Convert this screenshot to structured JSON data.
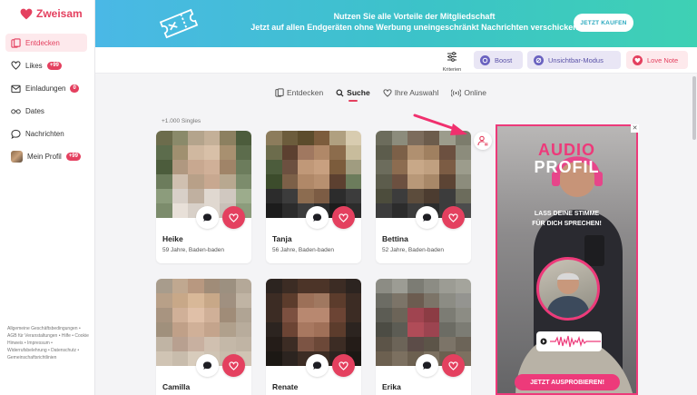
{
  "app": {
    "name": "Zweisam",
    "brand_color": "#e4405f"
  },
  "sidebar": {
    "items": [
      {
        "label": "Entdecken",
        "icon": "cards-icon",
        "active": true
      },
      {
        "label": "Likes",
        "icon": "heart-outline-icon",
        "badge": "+99"
      },
      {
        "label": "Einladungen",
        "icon": "envelope-icon",
        "badge": "0"
      },
      {
        "label": "Dates",
        "icon": "glasses-icon"
      },
      {
        "label": "Nachrichten",
        "icon": "chat-bubble-icon"
      },
      {
        "label": "Mein Profil",
        "icon": "avatar",
        "badge": "+99"
      }
    ],
    "footer": "Allgemeine Geschäftsbedingungen • AGB für Veranstaltungen • Hilfe • Cookie Hinweis • Impressum • Widerrufsbelehrung • Datenschutz • Gemeinschaftsrichtlinien"
  },
  "banner": {
    "line1": "Nutzen Sie alle Vorteile der Mitgliedschaft",
    "line2": "Jetzt auf allen Endgeräten ohne Werbung uneingeschränkt Nachrichten verschicken",
    "button": "JETZT KAUFEN"
  },
  "toolbar": {
    "criteria_label": "Kriterien",
    "boost": "Boost",
    "invisible": "Unsichtbar-Modus",
    "love_note": "Love Note"
  },
  "tabs": [
    {
      "label": "Entdecken",
      "icon": "cards-icon"
    },
    {
      "label": "Suche",
      "icon": "search-icon",
      "active": true
    },
    {
      "label": "Ihre Auswahl",
      "icon": "heart-outline-icon"
    },
    {
      "label": "Online",
      "icon": "signal-icon"
    }
  ],
  "results": {
    "count_label": "+1.000 Singles"
  },
  "profiles": [
    {
      "name": "Heike",
      "meta": "59 Jahre, Baden-baden"
    },
    {
      "name": "Tanja",
      "meta": "56 Jahre, Baden-baden"
    },
    {
      "name": "Bettina",
      "meta": "52 Jahre, Baden-baden"
    },
    {
      "name": "Camilla",
      "meta": ""
    },
    {
      "name": "Renate",
      "meta": ""
    },
    {
      "name": "Erika",
      "meta": ""
    }
  ],
  "ad": {
    "title1": "AUDIO",
    "title2": "PROFIL",
    "sub1": "LASS DEINE STIMME",
    "sub2": "FÜR DICH SPRECHEN!",
    "cta": "JETZT AUSPROBIEREN!",
    "close": "✕",
    "accent": "#ed3a7a"
  }
}
